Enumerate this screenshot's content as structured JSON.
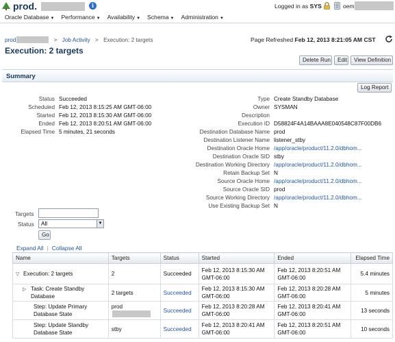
{
  "header": {
    "brand": "prod.",
    "menu": [
      "Oracle Database",
      "Performance",
      "Availability",
      "Schema",
      "Administration"
    ],
    "logged_prefix": "Logged in as",
    "logged_user": "SYS",
    "oem_label": "oem"
  },
  "breadcrumb": {
    "root": "prod",
    "job_activity": "Job Activity",
    "current": "Execution: 2 targets"
  },
  "page": {
    "title": "Execution: 2 targets",
    "refreshed_label": "Page Refreshed",
    "refreshed_value": "Feb 12, 2013 8:21:05 AM CST"
  },
  "actions": {
    "delete_run": "Delete Run",
    "edit": "Edit",
    "view_definition": "View Definition",
    "log_report": "Log Report"
  },
  "summary": {
    "title": "Summary",
    "left": [
      {
        "k": "Status",
        "v": "Succeeded"
      },
      {
        "k": "Scheduled",
        "v": "Feb 12, 2013 8:15:25 AM GMT-06:00"
      },
      {
        "k": "Started",
        "v": "Feb 12, 2013 8:15:30 AM GMT-06:00"
      },
      {
        "k": "Ended",
        "v": "Feb 12, 2013 8:20:51 AM GMT-06:00"
      },
      {
        "k": "Elapsed Time",
        "v": "5 minutes, 21 seconds"
      }
    ],
    "right": [
      {
        "k": "Type",
        "v": "Create Standby Database"
      },
      {
        "k": "Owner",
        "v": "SYSMAN"
      },
      {
        "k": "Description",
        "v": ""
      },
      {
        "k": "Execution ID",
        "v": "D58824F4A14BAAA8E040548C87F00DB6"
      },
      {
        "k": "Destination Database Name",
        "v": "prod"
      },
      {
        "k": "Destination Listener Name",
        "v": "listener_stby"
      },
      {
        "k": "Destination Oracle Home",
        "v": "/app/oracle/product/11.2.0/dbhom..."
      },
      {
        "k": "Destination Oracle SID",
        "v": "stby"
      },
      {
        "k": "Destination Working Directory",
        "v": "/app/oracle/product/11.2.0/dbhom..."
      },
      {
        "k": "Retain Backup Set",
        "v": "N"
      },
      {
        "k": "Source Oracle Home",
        "v": "/app/oracle/product/11.2.0/dbhom..."
      },
      {
        "k": "Source Oracle SID",
        "v": "prod"
      },
      {
        "k": "Source Working Directory",
        "v": "/app/oracle/product/11.2.0/dbhom..."
      },
      {
        "k": "Use Existing Backup Set",
        "v": "N"
      }
    ]
  },
  "filters": {
    "targets_label": "Targets",
    "targets_value": "",
    "status_label": "Status",
    "status_value": "All",
    "go": "Go",
    "expand_all": "Expand All",
    "collapse_all": "Collapse All"
  },
  "table": {
    "columns": [
      "Name",
      "Targets",
      "Status",
      "Started",
      "Ended",
      "Elapsed Time"
    ],
    "rows": [
      {
        "name": "Execution: 2 targets",
        "targets": "2",
        "status": "Succeeded",
        "started_1": "Feb 12, 2013 8:15:30 AM",
        "started_2": "GMT-06:00",
        "ended_1": "Feb 12, 2013 8:20:51 AM",
        "ended_2": "GMT-06:00",
        "elapsed": "5.4 minutes"
      },
      {
        "name": "Task: Create Standby Database",
        "targets": "2 targets",
        "status": "Succeeded",
        "started_1": "Feb 12, 2013 8:15:30 AM",
        "started_2": "GMT-06:00",
        "ended_1": "Feb 12, 2013 8:20:28 AM",
        "ended_2": "GMT-06:00",
        "elapsed": "5 minutes"
      },
      {
        "name": "Step: Update Primary Database State",
        "targets": "prod",
        "status": "Succeeded",
        "started_1": "Feb 12, 2013 8:20:28 AM",
        "started_2": "GMT-06:00",
        "ended_1": "Feb 12, 2013 8:20:41 AM",
        "ended_2": "GMT-06:00",
        "elapsed": "13 seconds"
      },
      {
        "name": "Step: Update Standby Database State",
        "targets": "stby",
        "status": "Succeeded",
        "started_1": "Feb 12, 2013 8:20:41 AM",
        "started_2": "GMT-06:00",
        "ended_1": "Feb 12, 2013 8:20:51 AM",
        "ended_2": "GMT-06:00",
        "elapsed": "10 seconds"
      }
    ]
  },
  "colors": {
    "title_blue": "#16375c",
    "link_blue": "#1f55a5",
    "header_border": "#c9d4de"
  },
  "icons": [
    "tree-icon",
    "info-icon",
    "lock-icon",
    "pin-icon",
    "refresh-icon",
    "chevron-down-icon",
    "disclosure-down-icon",
    "disclosure-right-icon"
  ]
}
